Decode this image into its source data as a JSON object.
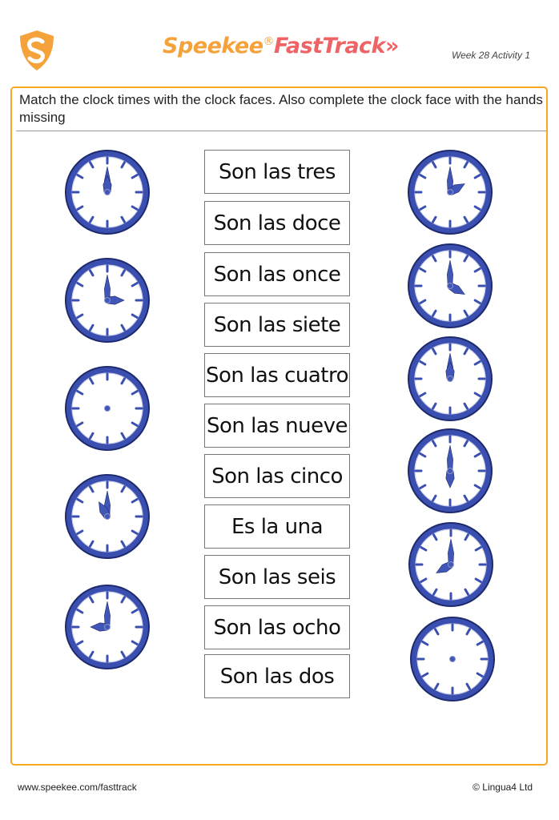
{
  "header": {
    "brand_part1": "Speekee",
    "registered_mark": "®",
    "brand_part2": "FastTrack",
    "brand_arrows": "»",
    "activity_label": "Week 28 Activity 1",
    "logo_icon": "shield-s-icon",
    "colors": {
      "orange": "#f5a23a",
      "coral": "#ee6466",
      "frame": "#f7a823"
    }
  },
  "instructions": "Match the clock times with the clock faces. Also complete the clock face with the hands missing",
  "left_clocks": [
    {
      "time": "12:00",
      "hour": 12,
      "hands": true
    },
    {
      "time": "3:00",
      "hour": 3,
      "hands": true
    },
    {
      "time": "",
      "hour": null,
      "hands": false
    },
    {
      "time": "11:00",
      "hour": 11,
      "hands": true
    },
    {
      "time": "9:00",
      "hour": 9,
      "hands": true
    }
  ],
  "phrases": [
    "Son las tres",
    "Son las doce",
    "Son las once",
    "Son las siete",
    "Son las cuatro",
    "Son las nueve",
    "Son las cinco",
    "Es la una",
    "Son las seis",
    "Son las ocho",
    "Son las dos"
  ],
  "right_clocks": [
    {
      "time": "2:00",
      "hour": 2,
      "hands": true
    },
    {
      "time": "4:00",
      "hour": 4,
      "hands": true
    },
    {
      "time": "12:00",
      "hour": 12,
      "hands": true
    },
    {
      "time": "6:00",
      "hour": 6,
      "hands": true
    },
    {
      "time": "8:00",
      "hour": 8,
      "hands": true
    },
    {
      "time": "",
      "hour": null,
      "hands": false
    }
  ],
  "clock_colors": {
    "rim": "#3a4fb0",
    "rim_dark": "#1e2a6e",
    "face": "#ffffff",
    "hand": "#4256b8"
  },
  "footer": {
    "url": "www.speekee.com/fasttrack",
    "copyright": "© Lingua4 Ltd"
  }
}
